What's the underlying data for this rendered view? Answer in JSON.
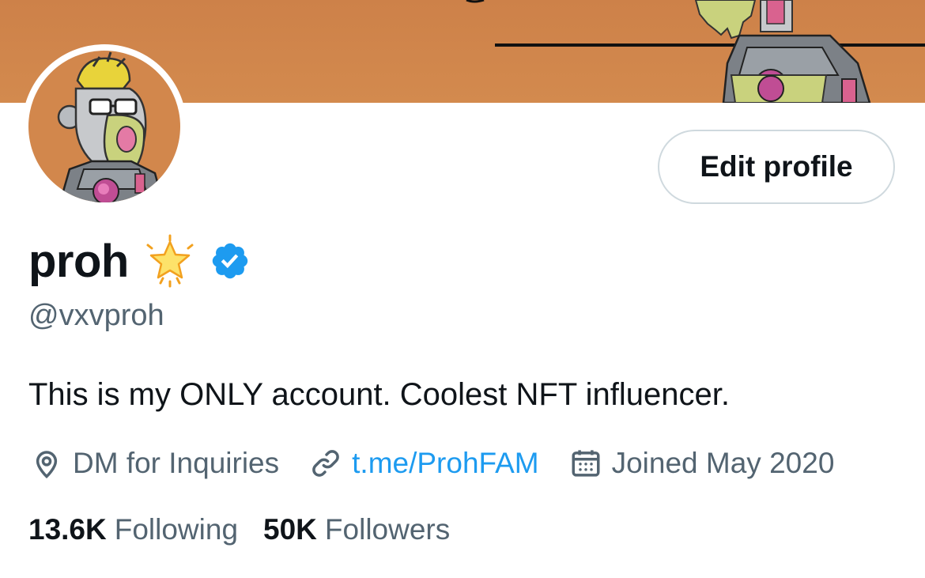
{
  "banner": {
    "color": "#cd8149"
  },
  "profile": {
    "name": "proh",
    "emoji": "🌟",
    "handle": "@vxvproh",
    "bio": "This is my ONLY account. Coolest NFT influencer.",
    "edit_profile_label": "Edit profile"
  },
  "meta": {
    "location": "DM for Inquiries",
    "website": "t.me/ProhFAM",
    "joined": "Joined May 2020"
  },
  "stats": {
    "following_count": "13.6K",
    "following_label": "Following",
    "followers_count": "50K",
    "followers_label": "Followers"
  },
  "icons": {
    "location": "location-pin-icon",
    "website": "link-icon",
    "joined": "calendar-icon",
    "verified": "verified-badge-icon",
    "star": "glowing-star-emoji-icon"
  },
  "colors": {
    "accent": "#1d9bf0",
    "verified": "#1d9bf0",
    "secondary_text": "#536471",
    "primary_text": "#0f1419"
  }
}
